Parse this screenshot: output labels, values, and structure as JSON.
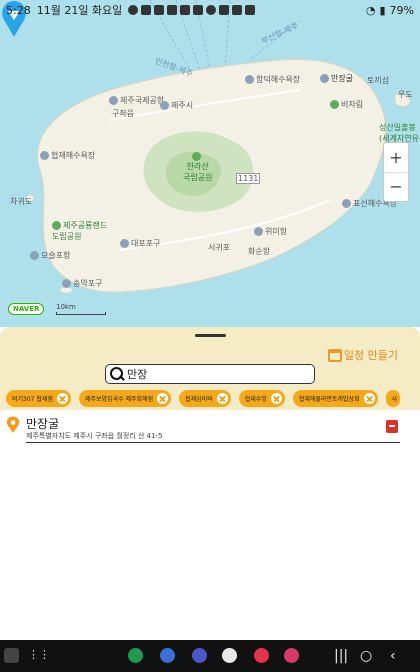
{
  "status_bar": {
    "time": "5:28",
    "date": "11월 21일 화요일",
    "battery": "79%"
  },
  "map": {
    "labels": {
      "hallim": "한림공원",
      "hallim_port": "협재해수욕장",
      "jeju_intl": "제주국제공항",
      "hamdeok": "함덕해수욕장",
      "manjanggul_map": "만장굴",
      "bijarim": "비자림",
      "tokkiseom": "토끼섬",
      "udo": "우도",
      "seongsan": "성산일출봉",
      "seongsan_sub": "(세계자연유산)",
      "hallasan": "한라산",
      "hallasan_sub": "국립공원",
      "road_1131": "1131",
      "gujwa": "구좌읍",
      "hyeopjae": "협재해수욕장",
      "jeju_city": "제주시",
      "pyoseon": "표선해수욕장",
      "namwon": "위미항",
      "jeju_air_park": "제주공룡랜드",
      "jeju_air_park_sub": "도립공원",
      "daejeong": "대포포구",
      "hwasun": "화순항",
      "seogwipo": "서귀포",
      "moseulpo": "모슬포항",
      "jagado": "차귀도",
      "sanbangsan": "산방산",
      "sanbang_port": "송악포구",
      "sea_route_1": "부산항-제주",
      "sea_route_2": "인천항-제주"
    },
    "zoom_in": "+",
    "zoom_out": "−",
    "logo": "NAVER",
    "scale_label": "10km"
  },
  "sheet": {
    "schedule_label": "일정 만들기",
    "search_value": "만장",
    "chips": [
      "비기307 협재점",
      "제주보양김국수 제주회해점",
      "협재심비바",
      "협재수엉",
      "협재해물라면토끼밥상회",
      "샤"
    ]
  },
  "result": {
    "title": "만장굴",
    "address": "제주특별자치도 제주시 구좌읍 월정리 산 41-5"
  },
  "navbar": {
    "recent": "|||",
    "home": "○",
    "back": "‹"
  },
  "colors": {
    "sea": "#aee0ec",
    "sheet": "#f5ecc6",
    "chip": "#f6a81b",
    "accent": "#d88c1c",
    "marker": "#2aa4e8"
  }
}
